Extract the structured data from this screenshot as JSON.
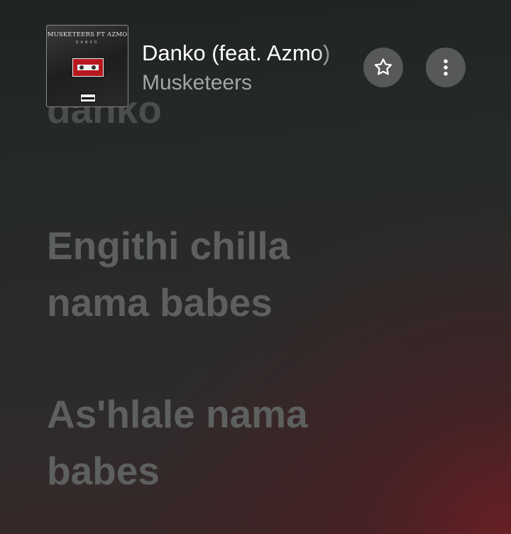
{
  "now_playing": {
    "title": "Danko (feat. Azmo)",
    "artist": "Musketeers",
    "artwork": {
      "title": "MUSKETEERS FT AZMO",
      "subtitle": "DANKO"
    },
    "favorite_icon": "star-outline-icon",
    "more_icon": "vertical-ellipsis-icon"
  },
  "lyrics": {
    "previous": "danko",
    "lines": [
      "Engithi chilla",
      "nama babes",
      "As'hlale nama",
      "babes"
    ]
  },
  "colors": {
    "title": "#ffffff",
    "artist": "#a3a6a4",
    "lyric_inactive": "#5d605e",
    "button_bg": "#565958",
    "accent_gradient": "#6e1e23"
  }
}
